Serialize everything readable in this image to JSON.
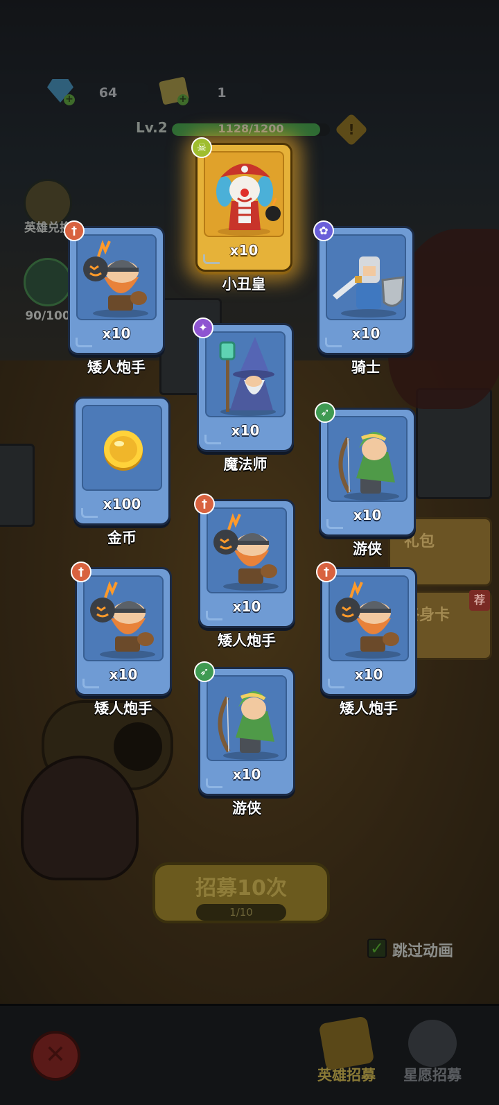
{
  "resources": {
    "gems": "64",
    "tickets": "1",
    "gem_icon": "diamond-gem-icon",
    "ticket_icon": "recruit-ticket-icon"
  },
  "level": {
    "label": "Lv.2",
    "xp_text": "1128/1200",
    "progress": 0.94
  },
  "side_menu": {
    "hero_exchange_label": "英雄兑换",
    "star_progress_label": "90/100"
  },
  "promos": {
    "gift_pack": "礼包",
    "lifetime_card": "终身卡",
    "recommend_tag": "荐"
  },
  "cards": [
    {
      "name": "小丑皇",
      "count": "x10",
      "class": "skull",
      "rarity": "legendary",
      "art": "clown-king"
    },
    {
      "name": "矮人炮手",
      "count": "x10",
      "class": "warrior",
      "rarity": "normal",
      "art": "dwarf-gunner"
    },
    {
      "name": "骑士",
      "count": "x10",
      "class": "beast",
      "rarity": "normal",
      "art": "knight"
    },
    {
      "name": "魔法师",
      "count": "x10",
      "class": "mage",
      "rarity": "normal",
      "art": "wizard"
    },
    {
      "name": "金币",
      "count": "x100",
      "class": "",
      "rarity": "normal",
      "art": "gold-coin"
    },
    {
      "name": "游侠",
      "count": "x10",
      "class": "archer",
      "rarity": "normal",
      "art": "ranger"
    },
    {
      "name": "矮人炮手",
      "count": "x10",
      "class": "warrior",
      "rarity": "normal",
      "art": "dwarf-gunner"
    },
    {
      "name": "矮人炮手",
      "count": "x10",
      "class": "warrior",
      "rarity": "normal",
      "art": "dwarf-gunner"
    },
    {
      "name": "矮人炮手",
      "count": "x10",
      "class": "warrior",
      "rarity": "normal",
      "art": "dwarf-gunner"
    },
    {
      "name": "游侠",
      "count": "x10",
      "class": "archer",
      "rarity": "normal",
      "art": "ranger"
    }
  ],
  "recruit": {
    "button_label": "招募10次",
    "progress_text": "1/10"
  },
  "skip_animation": {
    "label": "跳过动画",
    "checked": true
  },
  "bottom_nav": {
    "hero_recruit": "英雄招募",
    "star_wish_recruit": "星愿招募",
    "close_icon": "crossed-swords-close-icon"
  },
  "colors": {
    "card_blue": "#6f9bd4",
    "card_gold": "#e6b239",
    "warrior_badge": "#d8623f",
    "beast_badge": "#6a5fd9",
    "mage_badge": "#8e55d1",
    "archer_badge": "#3f9a52",
    "skull_badge": "#9fbd2e"
  }
}
